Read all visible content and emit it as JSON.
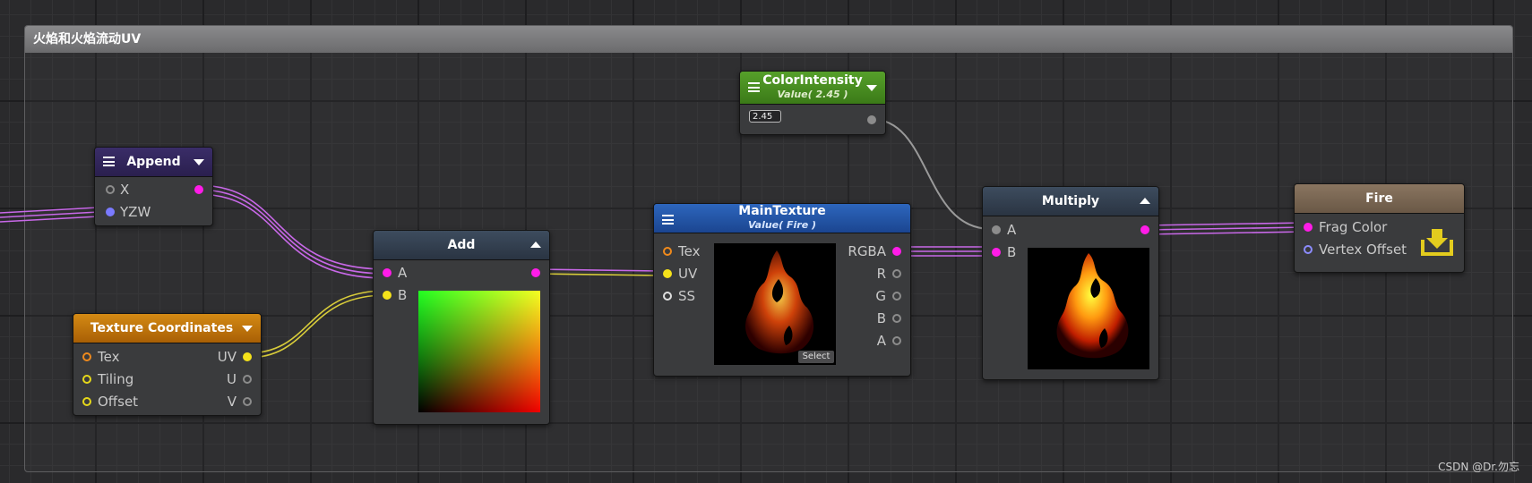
{
  "group": {
    "title": "火焰和火焰流动UV"
  },
  "nodes": {
    "append": {
      "title": "Append",
      "inputs": [
        "X",
        "YZW"
      ]
    },
    "texcoords": {
      "title": "Texture Coordinates",
      "inputs": [
        "Tex",
        "Tiling",
        "Offset"
      ],
      "outputs": [
        "UV",
        "U",
        "V"
      ]
    },
    "add": {
      "title": "Add",
      "inputs": [
        "A",
        "B"
      ]
    },
    "maintexture": {
      "title": "MainTexture",
      "subtitle": "Value( Fire )",
      "inputs": [
        "Tex",
        "UV",
        "SS"
      ],
      "outputs": [
        "RGBA",
        "R",
        "G",
        "B",
        "A"
      ],
      "select_label": "Select"
    },
    "colorintensity": {
      "title": "ColorIntensity",
      "subtitle": "Value( 2.45 )",
      "value": "2.45"
    },
    "multiply": {
      "title": "Multiply",
      "inputs": [
        "A",
        "B"
      ]
    },
    "fire": {
      "title": "Fire",
      "inputs": [
        "Frag Color",
        "Vertex Offset"
      ]
    }
  },
  "port_colors": {
    "color": "#ff1ce8",
    "float2": "#f5e21a",
    "float": "#8c8c8c",
    "float3": "#7a7aff"
  },
  "icons": {
    "menu": "menu-icon",
    "collapse": "triangle-icon",
    "output": "download-icon"
  },
  "watermark": "CSDN @Dr.勿忘"
}
